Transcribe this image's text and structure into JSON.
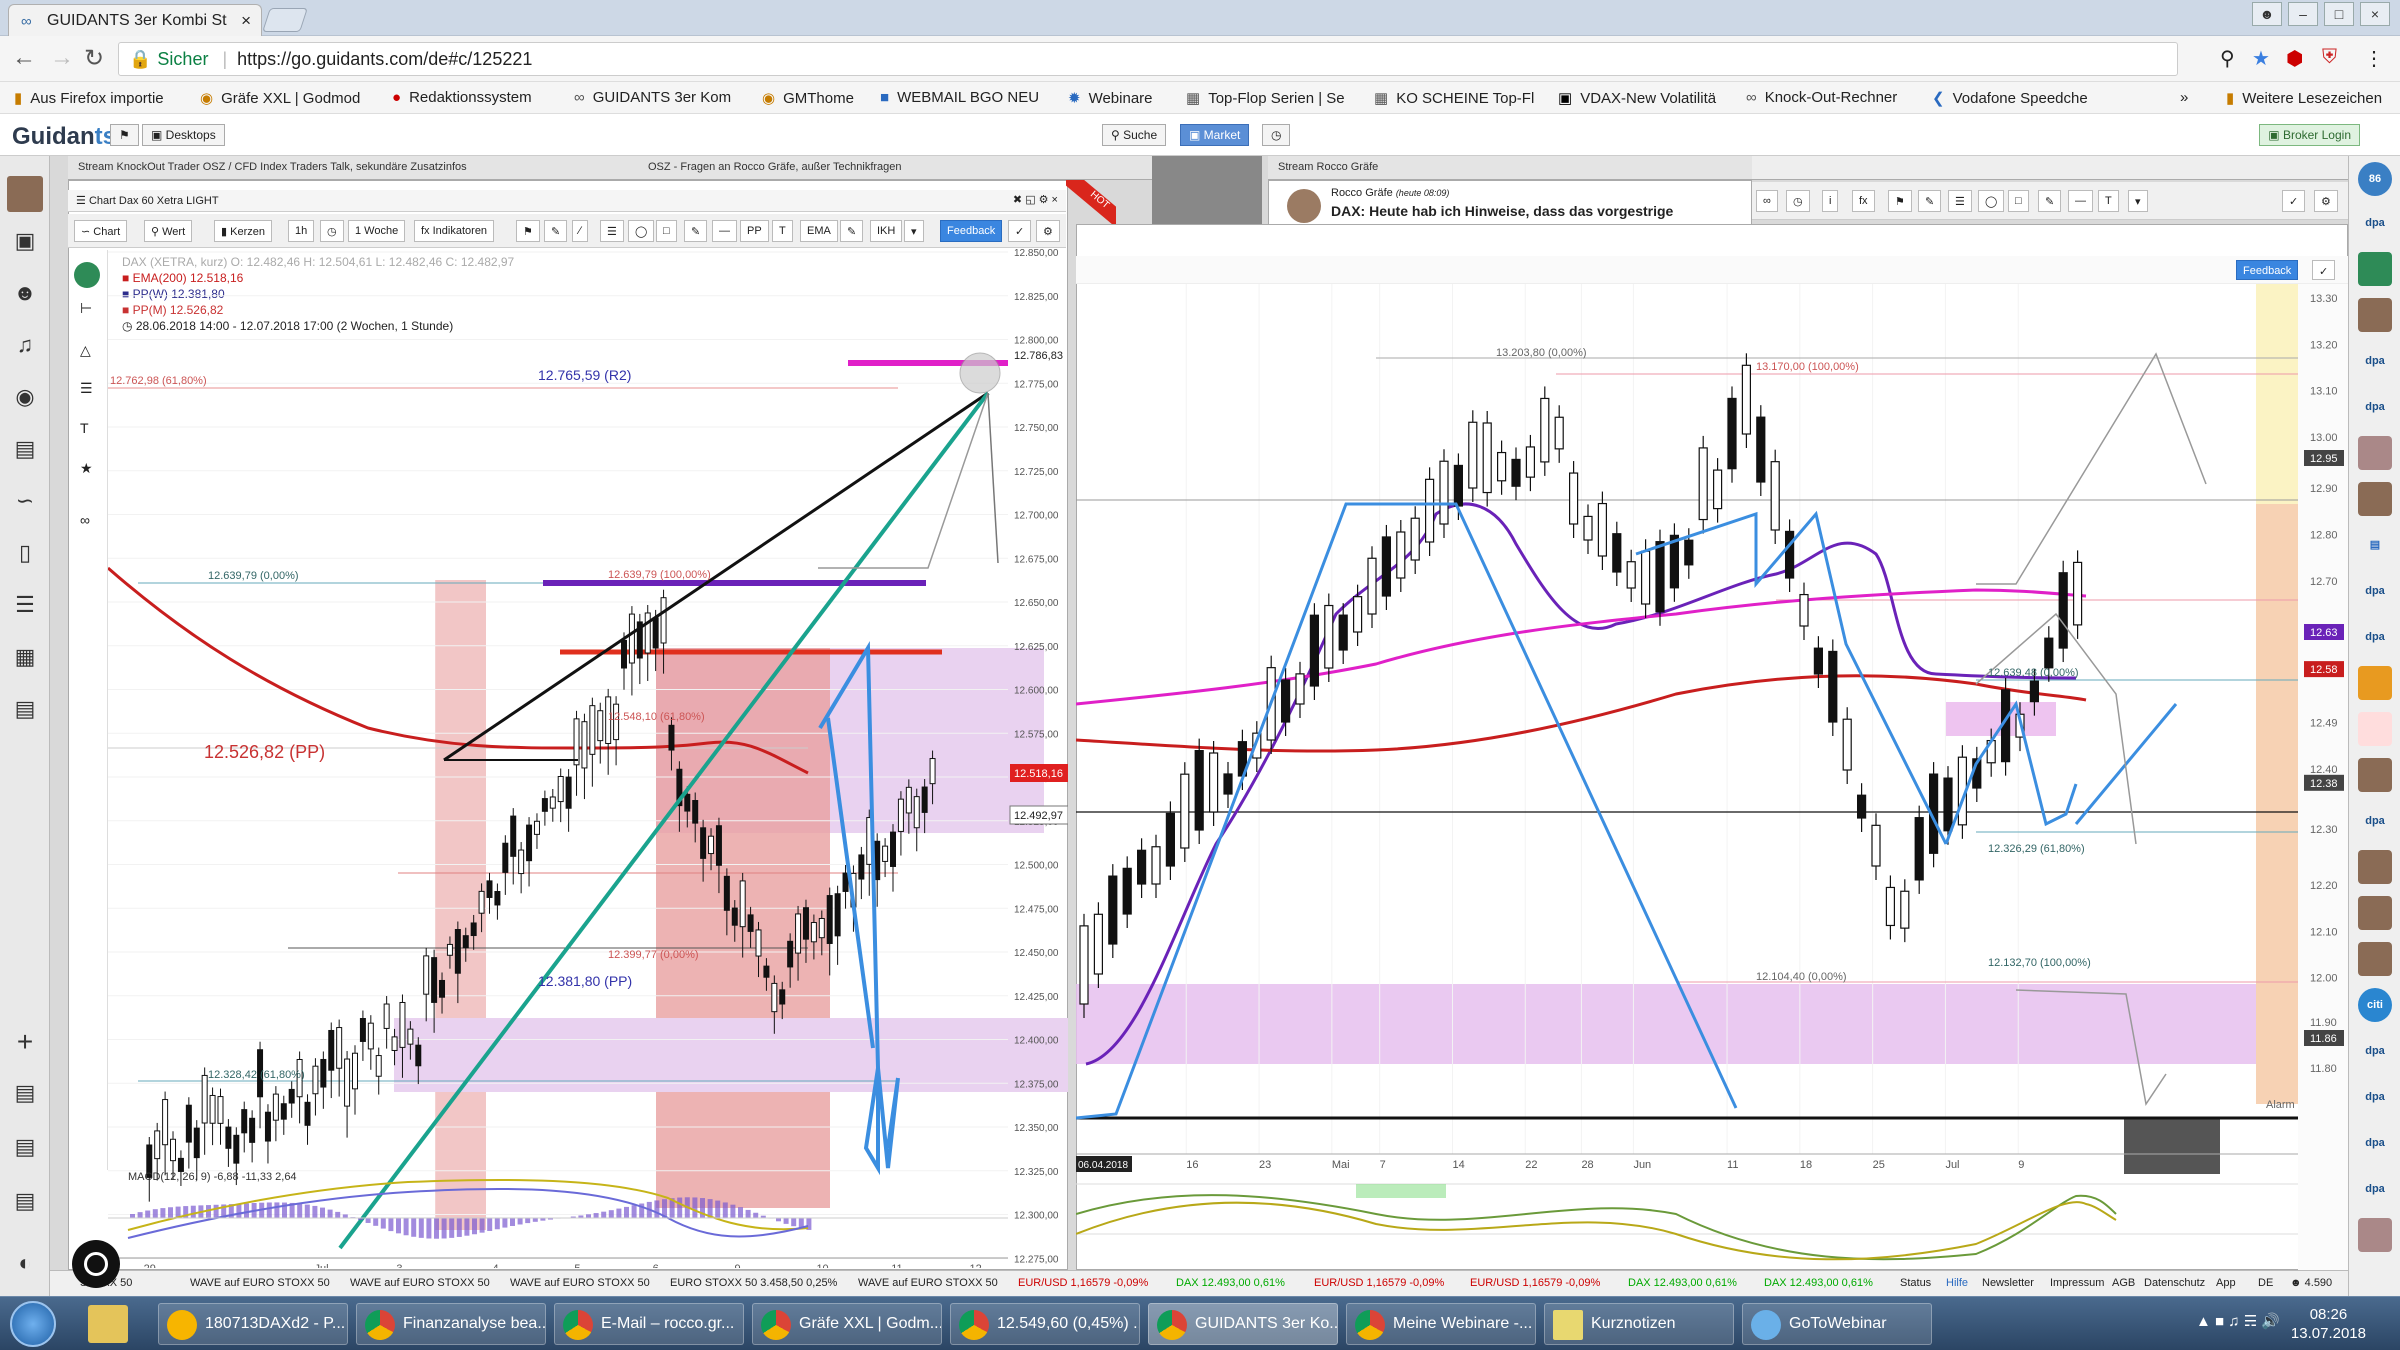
{
  "browser": {
    "tab_title": "GUIDANTS 3er Kombi St",
    "url_secure": "Sicher",
    "url": "https://go.guidants.com/de#c/125221",
    "bookmarks": [
      "Aus Firefox importie",
      "Gräfe XXL | Godmod",
      "Redaktionssystem",
      "GUIDANTS 3er Kom",
      "GMThome",
      "WEBMAIL BGO NEU",
      "Webinare",
      "Top-Flop Serien | Se",
      "KO SCHEINE Top-Fl",
      "VDAX-New Volatilitä",
      "Knock-Out-Rechner",
      "Vodafone Speedche"
    ],
    "bookmarks_more": "Weitere Lesezeichen"
  },
  "app": {
    "logo_main": "Guidan",
    "logo_accent": "ts",
    "desktops": "Desktops",
    "search": "Suche",
    "market": "Market",
    "broker_login": "Broker Login"
  },
  "panels": {
    "left_tab": "Stream KnockOut Trader OSZ / CFD Index Traders Talk, sekundäre Zusatzinfos",
    "mid_tab": "OSZ - Fragen an Rocco Gräfe, außer Technikfragen",
    "right_tab": "Stream Rocco Gräfe",
    "stream_author": "Rocco Gräfe",
    "stream_time": "(heute 08:09)",
    "stream_headline": "DAX: Heute hab ich Hinweise, dass das vorgestrige",
    "hot": "HOT"
  },
  "left_chart": {
    "title": "Chart Dax 60 Xetra LIGHT",
    "toolbar": [
      "Chart",
      "Wert",
      "Kerzen",
      "1h",
      "1 Woche",
      "Indikatoren"
    ],
    "toolbar_more": [
      "PP",
      "EMA",
      "IKH"
    ],
    "feedback": "Feedback",
    "legend_dax": "DAX (XETRA, kurz) O: 12.482,46 H: 12.504,61 L: 12.482,46 C: 12.482,97",
    "legend_ema": "EMA(200) 12.518,16",
    "legend_ppw": "PP(W) 12.381,80",
    "legend_ppm": "PP(M) 12.526,82",
    "legend_range": "28.06.2018 14:00 - 12.07.2018 17:00  (2 Wochen, 1 Stunde)",
    "yticks": [
      "12.850,00",
      "12.825,00",
      "12.800,00",
      "12.775,00",
      "12.750,00",
      "12.725,00",
      "12.700,00",
      "12.675,00",
      "12.650,00",
      "12.625,00",
      "12.600,00",
      "12.575,00",
      "12.550,00",
      "12.525,00",
      "12.500,00",
      "12.475,00",
      "12.450,00",
      "12.425,00",
      "12.400,00",
      "12.375,00",
      "12.350,00",
      "12.325,00",
      "12.300,00",
      "12.275,00"
    ],
    "xticks": [
      "29",
      "Jul",
      "3",
      "4",
      "5",
      "6",
      "9",
      "10",
      "11",
      "12"
    ],
    "labels": {
      "fib_top": "12.762,98 (61,80%)",
      "r2": "12.765,59 (R2)",
      "fib0": "12.639,79 (0,00%)",
      "fib100": "12.639,79 (100,00%)",
      "fib618b": "12.548,10 (61,80%)",
      "pp_month": "12.526,82 (PP)",
      "fib0b": "12.399,77 (0,00%)",
      "pp_week": "12.381,80 (PP)",
      "fib_low": "12.328,42 (61,80%)",
      "price_ema": "12.518,16",
      "price_last": "12.492,97",
      "price_top": "12.786,83"
    },
    "macd": "MACD(12, 26, 9) -6,88 -11,33 2,64"
  },
  "right_chart": {
    "feedback": "Feedback",
    "xticks": [
      "16",
      "23",
      "Mai",
      "7",
      "14",
      "22",
      "28",
      "Jun",
      "11",
      "18",
      "25",
      "Jul",
      "9"
    ],
    "x_start": "06.04.2018",
    "yticks": [
      "13.30",
      "13.20",
      "13.10",
      "13.00",
      "12.95",
      "12.90",
      "12.80",
      "12.70",
      "12.63",
      "12.58",
      "12.49",
      "12.40",
      "12.38",
      "12.30",
      "12.20",
      "12.10",
      "12.00",
      "11.90",
      "11.86",
      "11.80"
    ],
    "labels": {
      "high1": "13.203,80 (0,00%)",
      "high2": "13.170,00 (100,00%)",
      "fib_mid": "12.639,48 (0,00%)",
      "fib_618": "12.326,29 (61,80%)",
      "low1": "12.104,40 (0,00%)",
      "fib_low": "12.132,70 (100,00%)",
      "alarm": "Alarm"
    }
  },
  "statusbar": [
    "STOXX 50",
    "WAVE auf EURO STOXX 50",
    "WAVE auf EURO STOXX 50",
    "WAVE auf EURO STOXX 50",
    "EURO STOXX 50 3.458,50 0,25%",
    "WAVE auf EURO STOXX 50",
    "EUR/USD 1,16579 -0,09%",
    "DAX 12.493,00 0,61%",
    "EUR/USD 1,16579 -0,09%",
    "EUR/USD 1,16579 -0,09%",
    "DAX 12.493,00 0,61%",
    "DAX 12.493,00 0,61%"
  ],
  "statuslinks": [
    "Status",
    "Hilfe",
    "Newsletter",
    "Impressum",
    "AGB",
    "Datenschutz",
    "App",
    "DE"
  ],
  "status_users": "4.590",
  "taskbar": [
    "180713DAXd2 - P...",
    "Finanzanalyse bea...",
    "E-Mail – rocco.gr...",
    "Gräfe XXL | Godm...",
    "12.549,60 (0,45%) ...",
    "GUIDANTS 3er Ko...",
    "Meine Webinare -...",
    "Kurznotizen",
    "GoToWebinar"
  ],
  "clock_time": "08:26",
  "clock_date": "13.07.2018",
  "colors": {
    "ema": "#c81e1e",
    "fib": "#e88",
    "blue": "#3b8ee0",
    "teal": "#1aa38e",
    "magenta": "#e020c8",
    "purple": "#6a22b8",
    "pink_zone": "#e6c0ef",
    "red_zone": "#e9a0a0"
  }
}
